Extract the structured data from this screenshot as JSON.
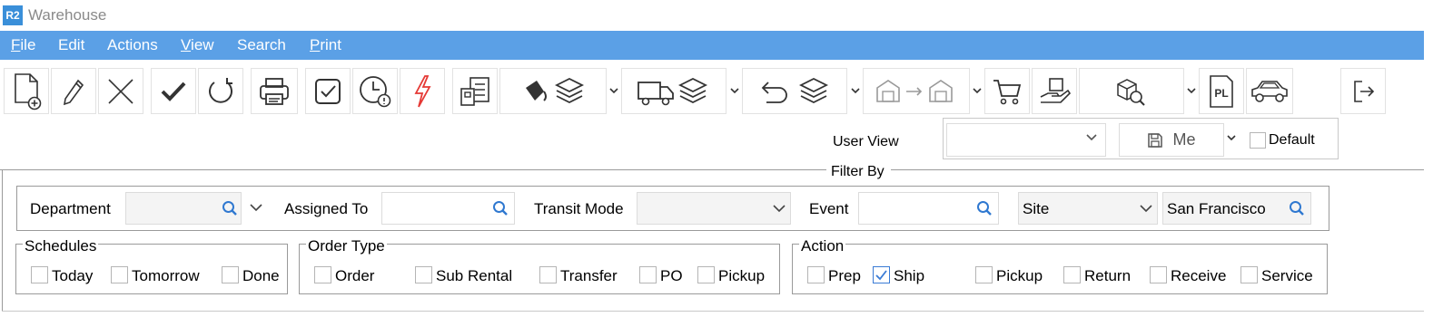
{
  "app": {
    "logo": "R2",
    "title": "Warehouse"
  },
  "menu": [
    "File",
    "Edit",
    "Actions",
    "View",
    "Search",
    "Print"
  ],
  "toolbar": {
    "icons": [
      "new-document-icon",
      "edit-pencil-icon",
      "delete-x-icon",
      "approve-check-icon",
      "refresh-icon",
      "print-icon",
      "checkbox-task-icon",
      "clock-alert-icon",
      "lightning-icon",
      "checklist-icon",
      "paint-bucket-layers-icon",
      "truck-layers-icon",
      "undo-layers-icon",
      "warehouse-transfer-icon",
      "cart-icon",
      "hand-box-icon",
      "box-search-icon",
      "pl-icon",
      "car-icon",
      "exit-icon"
    ],
    "pl_text": "PL"
  },
  "user_view": {
    "label": "User View",
    "select_value": "",
    "save_label": "Me",
    "default_label": "Default",
    "default_checked": false
  },
  "filter": {
    "legend": "Filter By",
    "department": {
      "label": "Department",
      "value": ""
    },
    "assigned_to": {
      "label": "Assigned To",
      "value": ""
    },
    "transit_mode": {
      "label": "Transit Mode",
      "value": ""
    },
    "event": {
      "label": "Event",
      "value": ""
    },
    "site": {
      "label": "Site",
      "value": "San Francisco"
    }
  },
  "schedules": {
    "title": "Schedules",
    "items": [
      {
        "label": "Today",
        "checked": false
      },
      {
        "label": "Tomorrow",
        "checked": false
      },
      {
        "label": "Done",
        "checked": false
      }
    ]
  },
  "order_type": {
    "title": "Order Type",
    "items": [
      {
        "label": "Order",
        "checked": false
      },
      {
        "label": "Sub Rental",
        "checked": false
      },
      {
        "label": "Transfer",
        "checked": false
      },
      {
        "label": "PO",
        "checked": false
      },
      {
        "label": "Pickup",
        "checked": false
      }
    ]
  },
  "action": {
    "title": "Action",
    "items": [
      {
        "label": "Prep",
        "checked": false
      },
      {
        "label": "Ship",
        "checked": true
      },
      {
        "label": "Pickup",
        "checked": false
      },
      {
        "label": "Return",
        "checked": false
      },
      {
        "label": "Receive",
        "checked": false
      },
      {
        "label": "Service",
        "checked": false
      }
    ]
  },
  "colors": {
    "menubar": "#5ba0e6",
    "accent": "#3a7bd5",
    "logo": "#3a8fd9",
    "lightning": "#e53935"
  }
}
